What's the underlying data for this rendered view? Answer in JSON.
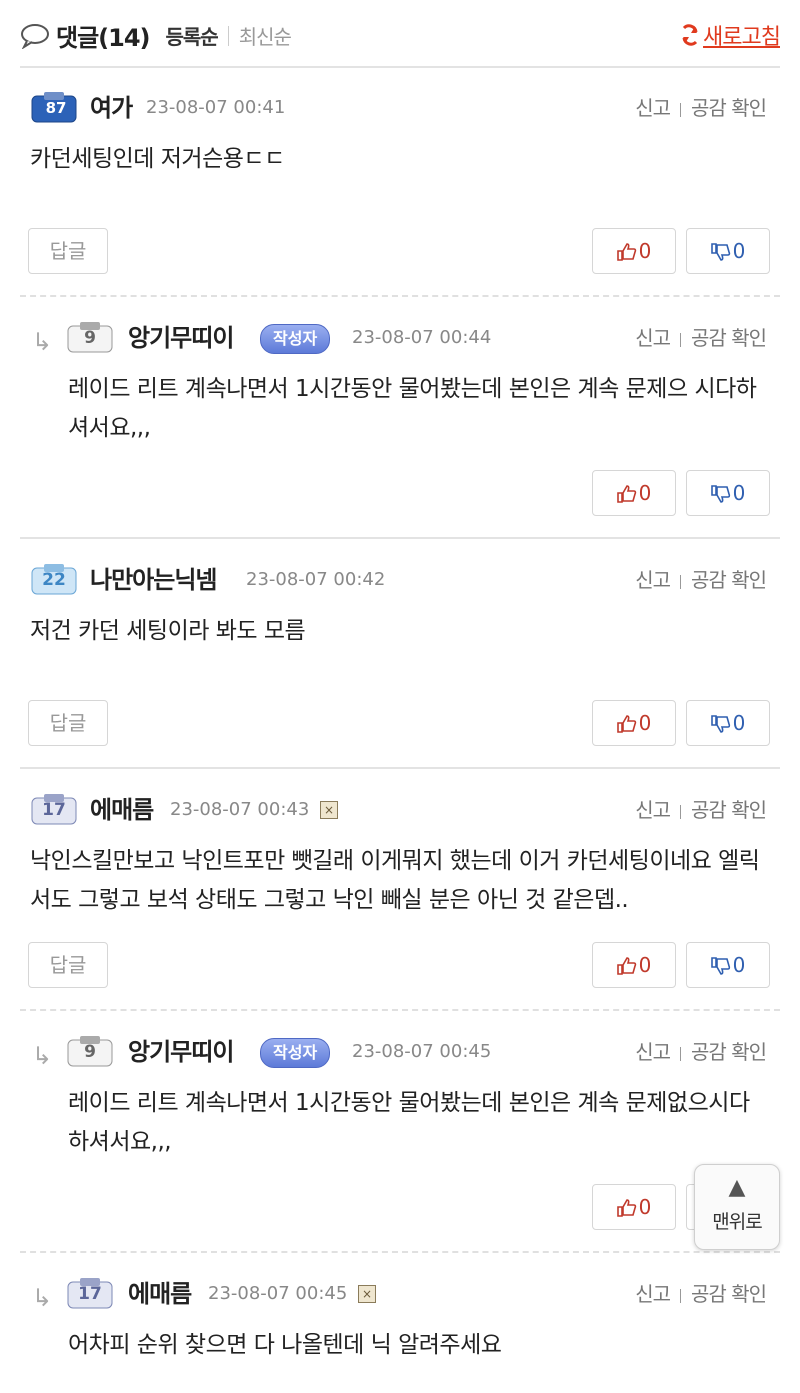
{
  "header": {
    "title": "댓글(14)",
    "sort_active": "등록순",
    "sort_inactive": "최신순",
    "refresh_label": "새로고침"
  },
  "labels": {
    "report": "신고",
    "likes_check": "공감 확인",
    "reply": "답글",
    "author_badge": "작성자",
    "scroll_top": "맨위로"
  },
  "comments": [
    {
      "level": "87",
      "nick": "여가",
      "date": "23-08-07 00:41",
      "text": "카던세팅인데 저거슨용ㄷㄷ",
      "up": "0",
      "down": "0"
    },
    {
      "level": "9",
      "nick": "앙기무띠이",
      "date": "23-08-07 00:44",
      "text": "레이드 리트 계속나면서 1시간동안 물어봤는데 본인은 계속 문제으 시다하셔서요,,,",
      "up": "0",
      "down": "0"
    },
    {
      "level": "22",
      "nick": "나만아는닉넴",
      "date": "23-08-07 00:42",
      "text": "저건 카던 세팅이라 봐도 모름",
      "up": "0",
      "down": "0"
    },
    {
      "level": "17",
      "nick": "에매름",
      "date": "23-08-07 00:43",
      "text": "낙인스킬만보고 낙인트포만 뺏길래 이게뭐지 했는데 이거 카던세팅이네요 엘릭서도 그렇고 보석 상태도 그렇고 낙인 빼실 분은 아닌 것 같은뎁..",
      "up": "0",
      "down": "0"
    },
    {
      "level": "9",
      "nick": "앙기무띠이",
      "date": "23-08-07 00:45",
      "text": "레이드 리트 계속나면서 1시간동안 물어봤는데 본인은 계속 문제없으시다하셔서요,,,",
      "up": "0",
      "down": ""
    },
    {
      "level": "17",
      "nick": "에매름",
      "date": "23-08-07 00:45",
      "text": "어차피 순위 찾으면 다 나올텐데 닉 알려주세요",
      "up": "",
      "down": ""
    }
  ],
  "colors": {
    "accent": "#e03a1e",
    "up": "#c0392b",
    "down": "#2f5fb0",
    "badge": "#5d7ad8"
  }
}
